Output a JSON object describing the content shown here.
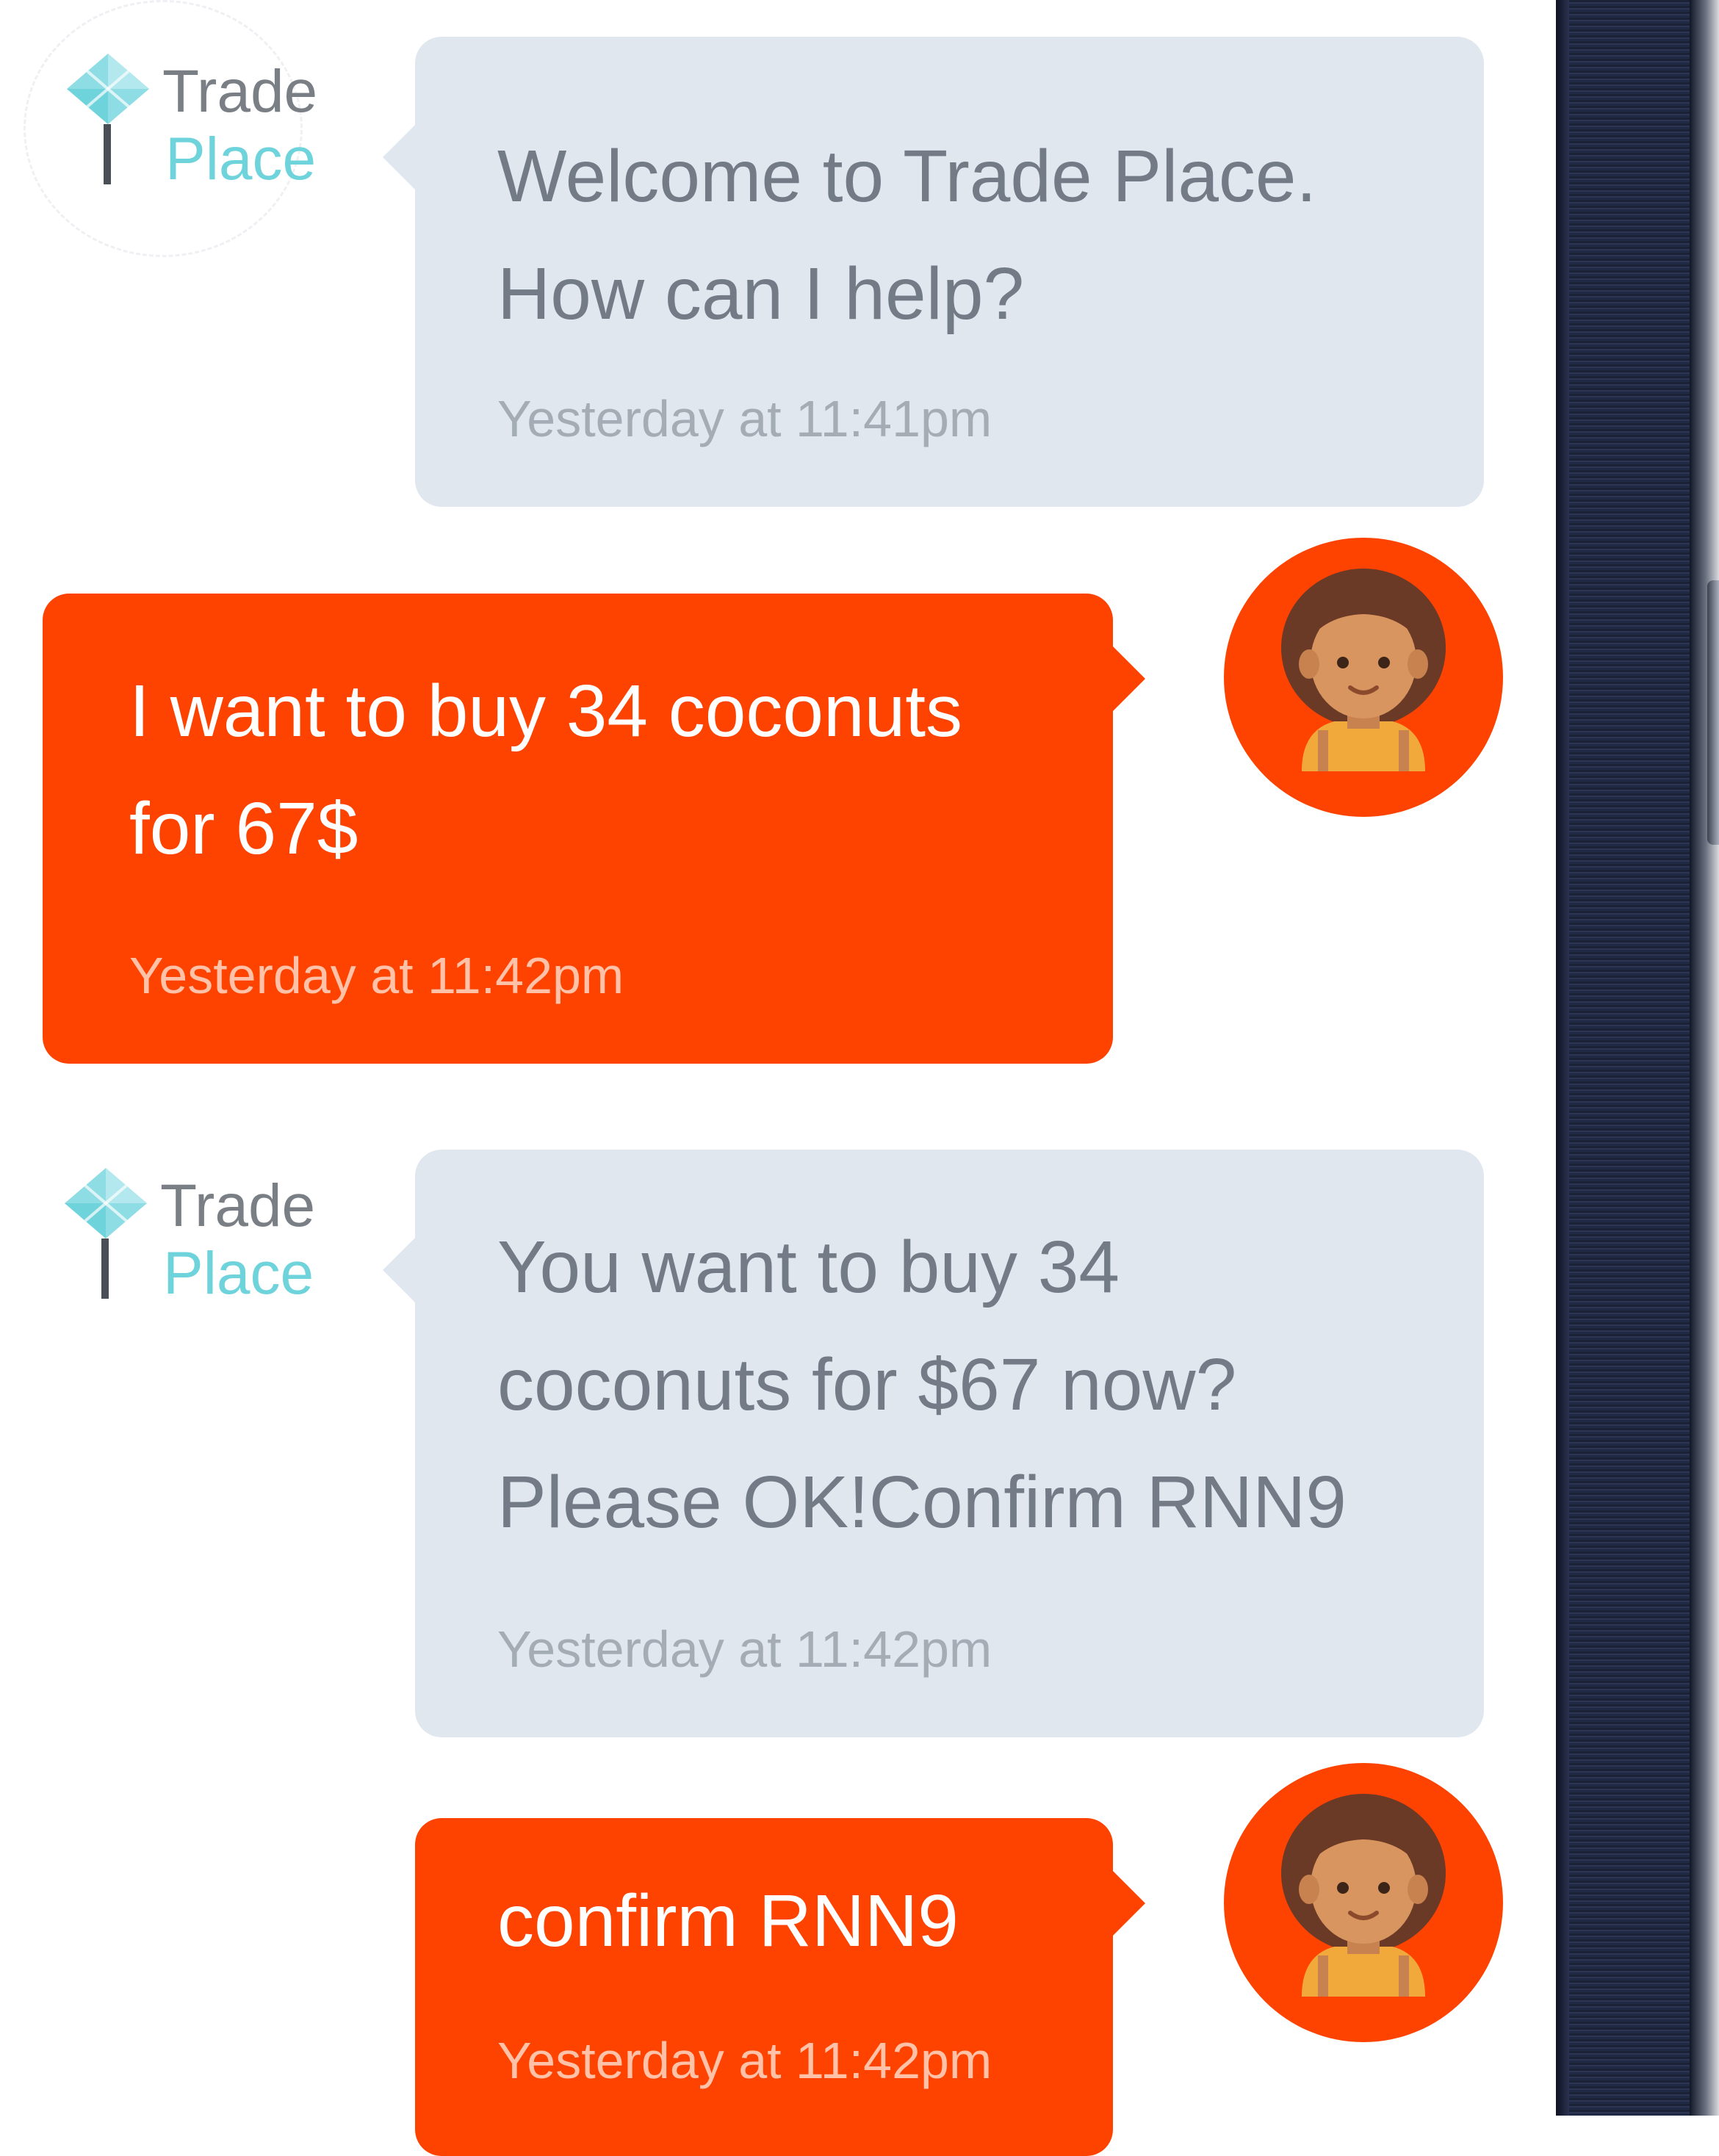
{
  "brand": {
    "line1": "Trade",
    "line2": "Place",
    "accent_color": "#6fd3dc",
    "user_bubble_color": "#fe4301",
    "bot_bubble_color": "#e0e7ef"
  },
  "messages": [
    {
      "sender": "bot",
      "lines": [
        "Welcome to Trade Place.",
        "How can I help?"
      ],
      "time": "Yesterday at 11:41pm"
    },
    {
      "sender": "user",
      "lines": [
        "I want to buy 34 coconuts",
        "for 67$"
      ],
      "time": "Yesterday at 11:42pm"
    },
    {
      "sender": "bot",
      "lines": [
        "You want to buy 34",
        "coconuts for $67 now?",
        "Please OK!Confirm RNN9"
      ],
      "time": "Yesterday at 11:42pm"
    },
    {
      "sender": "user",
      "lines": [
        "confirm RNN9"
      ],
      "time": "Yesterday at 11:42pm"
    }
  ],
  "icons": {
    "bot_avatar": "trade-place-logo-icon",
    "user_avatar": "user-avatar-icon"
  }
}
